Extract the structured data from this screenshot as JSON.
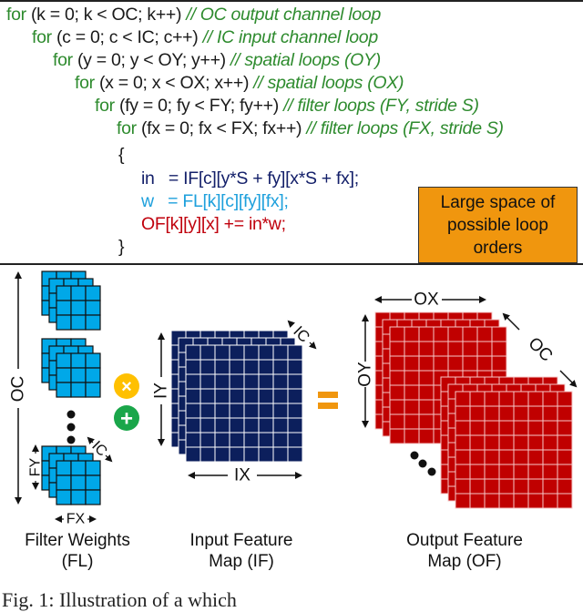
{
  "code": {
    "lines": [
      {
        "kw": "for",
        "args": "(k = 0; k < OC; k++)",
        "comment": "// OC output channel loop"
      },
      {
        "kw": "for",
        "args": "(c = 0; c < IC; c++)",
        "comment": "// IC input channel loop"
      },
      {
        "kw": "for",
        "args": "(y = 0; y < OY; y++)",
        "comment": "// spatial loops (OY)"
      },
      {
        "kw": "for",
        "args": "(x = 0; x < OX; x++)",
        "comment": "// spatial loops (OX)"
      },
      {
        "kw": "for",
        "args": "(fy = 0; fy < FY; fy++)",
        "comment": "// filter loops (FY, stride S)"
      },
      {
        "kw": "for",
        "args": "(fx = 0; fx < FX; fx++)",
        "comment": "// filter loops (FX, stride S)"
      }
    ],
    "open_brace": "{",
    "close_brace": "}",
    "body": {
      "in_line": "in   = IF[c][y*S + fy][x*S + fx];",
      "w_line": "w   = FL[k][c][fy][fx];",
      "of_line": "OF[k][y][x] += in*w;"
    },
    "colors": {
      "keyword": "#2e8b2e",
      "input": "#14206a",
      "weight": "#1ea0dc",
      "output": "#c0000c"
    }
  },
  "note": {
    "lines": [
      "Large space of",
      "possible loop",
      "orders"
    ],
    "color": "#f0960e"
  },
  "diagram": {
    "filter": {
      "dims": {
        "oc": "OC",
        "fy": "FY",
        "fx": "FX",
        "ic": "IC"
      },
      "label_line1": "Filter Weights",
      "label_line2": "(FL)",
      "color": "#00a8e8"
    },
    "ops": {
      "multiply": "×",
      "add": "+",
      "multiply_color": "#ffc000",
      "add_color": "#1aa64a"
    },
    "input": {
      "dims": {
        "iy": "IY",
        "ix": "IX",
        "ic": "IC"
      },
      "label_line1": "Input Feature",
      "label_line2": "Map (IF)",
      "color": "#0c1f5c"
    },
    "equals": {
      "color": "#f0960e"
    },
    "output": {
      "dims": {
        "oy": "OY",
        "ox": "OX",
        "oc": "OC"
      },
      "label_line1": "Output Feature",
      "label_line2": "Map (OF)",
      "color": "#c00000"
    }
  },
  "caption": "Fig. 1:  Illustration of a  which"
}
